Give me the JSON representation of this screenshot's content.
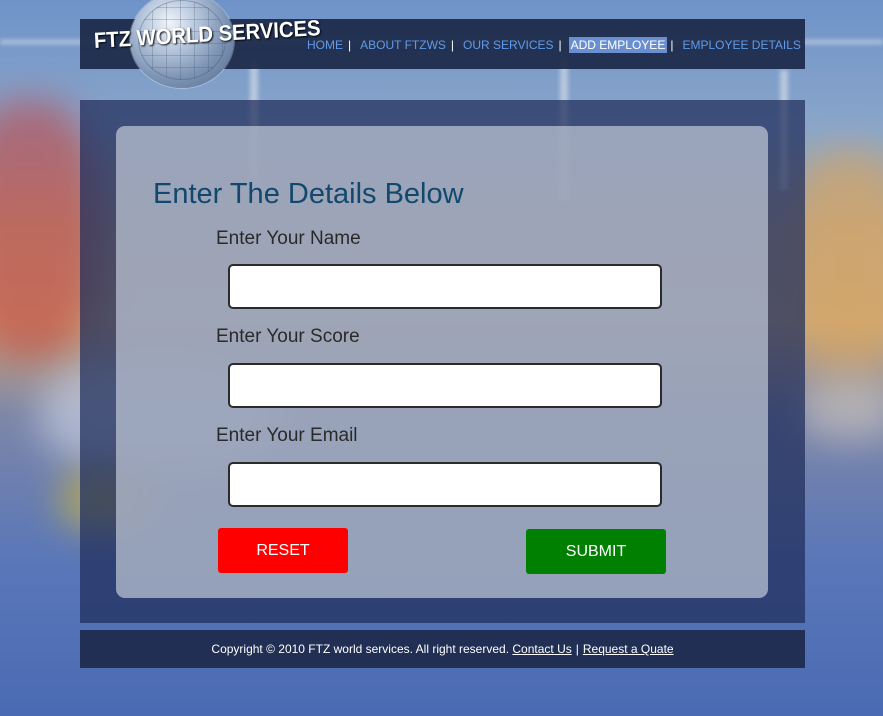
{
  "header": {
    "logo_text": "FTZ WORLD SERVICES",
    "nav": [
      {
        "label": "HOME"
      },
      {
        "label": "ABOUT FTZWS"
      },
      {
        "label": "OUR SERVICES"
      },
      {
        "label": "ADD EMPLOYEE",
        "active": true
      },
      {
        "label": "EMPLOYEE DETAILS"
      }
    ],
    "separator": "|"
  },
  "form": {
    "title": "Enter The Details Below",
    "name_label": "Enter Your Name",
    "name_value": "",
    "score_label": "Enter Your Score",
    "score_value": "",
    "email_label": "Enter Your Email",
    "email_value": "",
    "reset_label": "RESET",
    "submit_label": "SUBMIT"
  },
  "footer": {
    "copyright": "Copyright © 2010 FTZ world services. All right reserved.",
    "contact_link": "Contact Us",
    "separator": "|",
    "quote_link": "Request a Quate"
  },
  "colors": {
    "reset_button": "#ff0000",
    "submit_button": "#008000",
    "title": "#13486e",
    "nav_link": "#5f9be8",
    "nav_active_bg": "#6a8fd0"
  }
}
